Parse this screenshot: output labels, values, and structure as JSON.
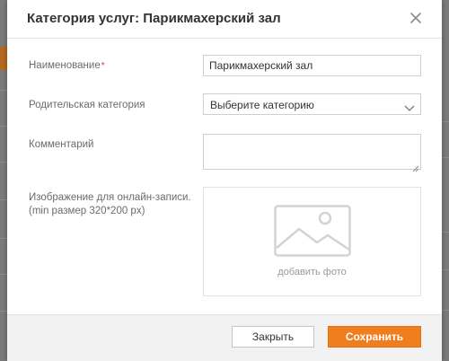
{
  "modal": {
    "title": "Категория услуг: Парикмахерский зал",
    "close_icon": "close-icon"
  },
  "form": {
    "name": {
      "label": "Наименование",
      "required_mark": "*",
      "value": "Парикмахерский зал"
    },
    "parent_category": {
      "label": "Родительская категория",
      "selected": "Выберите категорию",
      "icon": "chevron-down-icon"
    },
    "comment": {
      "label": "Комментарий",
      "value": ""
    },
    "image": {
      "label_line1": "Изображение для онлайн-записи.",
      "label_line2": "(min размер 320*200 px)",
      "upload_text": "добавить фото",
      "icon": "image-placeholder-icon"
    }
  },
  "footer": {
    "close_label": "Закрыть",
    "save_label": "Сохранить"
  },
  "colors": {
    "accent": "#f07e1f",
    "required": "#e0362c",
    "label": "#6b6b6b"
  }
}
